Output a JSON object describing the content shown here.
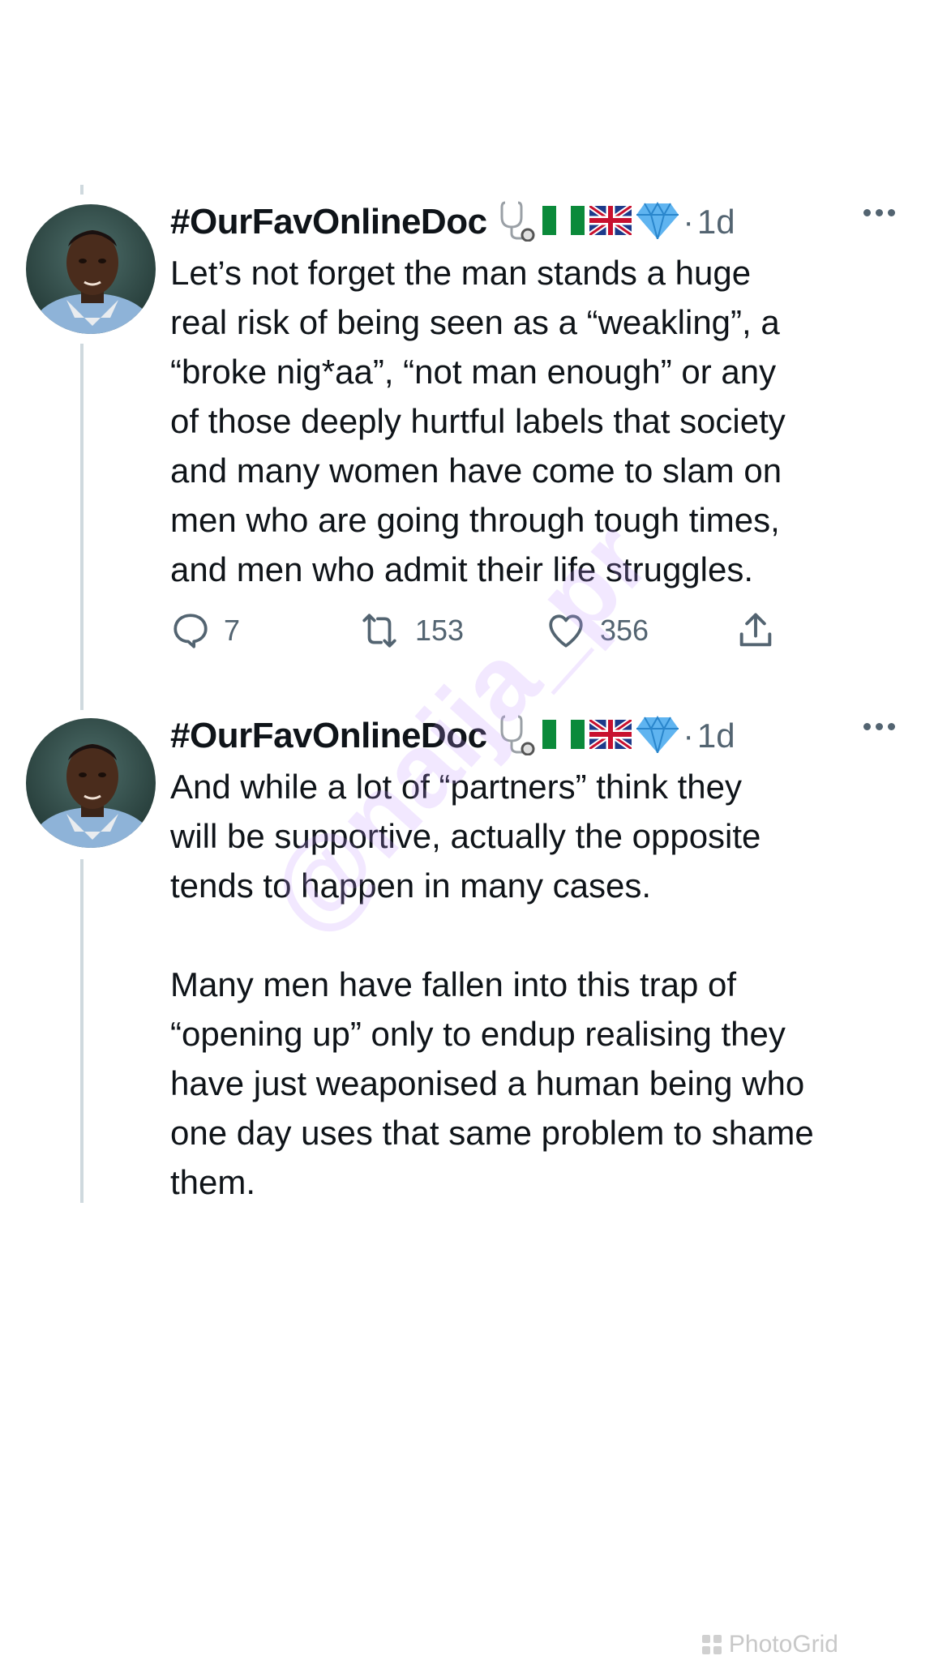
{
  "tweets": [
    {
      "author_name": "#OurFavOnlineDoc",
      "time": "1d",
      "separator": "·",
      "text": "Let’s not forget the man stands a huge\nreal risk of being seen as a “weakling”, a\n“broke nig*aa”, “not man enough” or any\nof those deeply hurtful labels that society\nand many women have come to slam on\nmen who are going through tough times,\nand men who admit their life struggles.",
      "replies": "7",
      "retweets": "153",
      "likes": "356"
    },
    {
      "author_name": "#OurFavOnlineDoc",
      "time": "1d",
      "separator": "·",
      "text": "And while a lot of “partners” think they\nwill be supportive, actually the opposite\ntends to happen in many cases.\n\nMany men have fallen into this trap of\n“opening up” only to endup realising they\nhave just weaponised a human being who\none day uses that same problem to shame\nthem."
    }
  ],
  "icons": {
    "name_emojis": [
      "stethoscope-icon",
      "nigeria-flag-icon",
      "uk-flag-icon",
      "gem-icon"
    ],
    "actions": [
      "reply-icon",
      "retweet-icon",
      "like-icon",
      "share-icon"
    ]
  },
  "colors": {
    "text": "#0f1419",
    "secondary": "#536471",
    "thread_line": "#cfd9de",
    "watermark": "#c896ff"
  },
  "watermark": "@naija_pr",
  "footer": {
    "brand": "PhotoGrid"
  }
}
